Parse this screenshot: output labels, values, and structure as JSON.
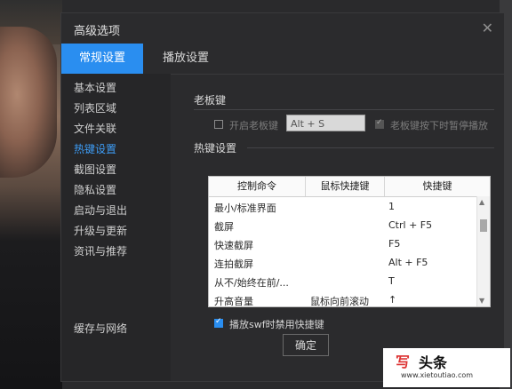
{
  "dialog": {
    "title": "高级选项",
    "close_glyph": "✕"
  },
  "tabs": [
    {
      "label": "常规设置",
      "active": true
    },
    {
      "label": "播放设置",
      "active": false
    }
  ],
  "sidebar": {
    "items": [
      {
        "label": "基本设置"
      },
      {
        "label": "列表区域"
      },
      {
        "label": "文件关联"
      },
      {
        "label": "热键设置",
        "active": true
      },
      {
        "label": "截图设置"
      },
      {
        "label": "隐私设置"
      },
      {
        "label": "启动与退出"
      },
      {
        "label": "升级与更新"
      },
      {
        "label": "资讯与推荐"
      }
    ],
    "bottom_item": "缓存与网络"
  },
  "boss_key": {
    "section_title": "老板键",
    "enable_label": "开启老板键",
    "enable_checked": false,
    "key_value": "Alt + S",
    "pause_label": "老板键按下时暂停播放",
    "pause_checked": true
  },
  "hotkeys": {
    "section_title": "热键设置",
    "columns": [
      "控制命令",
      "鼠标快捷键",
      "快捷键"
    ],
    "rows": [
      {
        "command": "最小/标准界面",
        "mouse": "",
        "key": "1"
      },
      {
        "command": "截屏",
        "mouse": "",
        "key": "Ctrl + F5"
      },
      {
        "command": "快速截屏",
        "mouse": "",
        "key": "F5"
      },
      {
        "command": "连拍截屏",
        "mouse": "",
        "key": "Alt + F5"
      },
      {
        "command": "从不/始终在前/...",
        "mouse": "",
        "key": "T"
      },
      {
        "command": "升高音量",
        "mouse": "鼠标向前滚动",
        "key": "↑"
      }
    ]
  },
  "swf_option": {
    "label": "播放swf时禁用快捷键",
    "checked": true
  },
  "buttons": {
    "ok": "确定"
  },
  "watermark": {
    "brand_glyph": "写",
    "brand": "头条",
    "url": "www.xietoutiao.com"
  },
  "colors": {
    "accent": "#2a8ef0",
    "active_sidebar": "#3d9cf5",
    "dialog_bg": "#2b2b2d"
  }
}
